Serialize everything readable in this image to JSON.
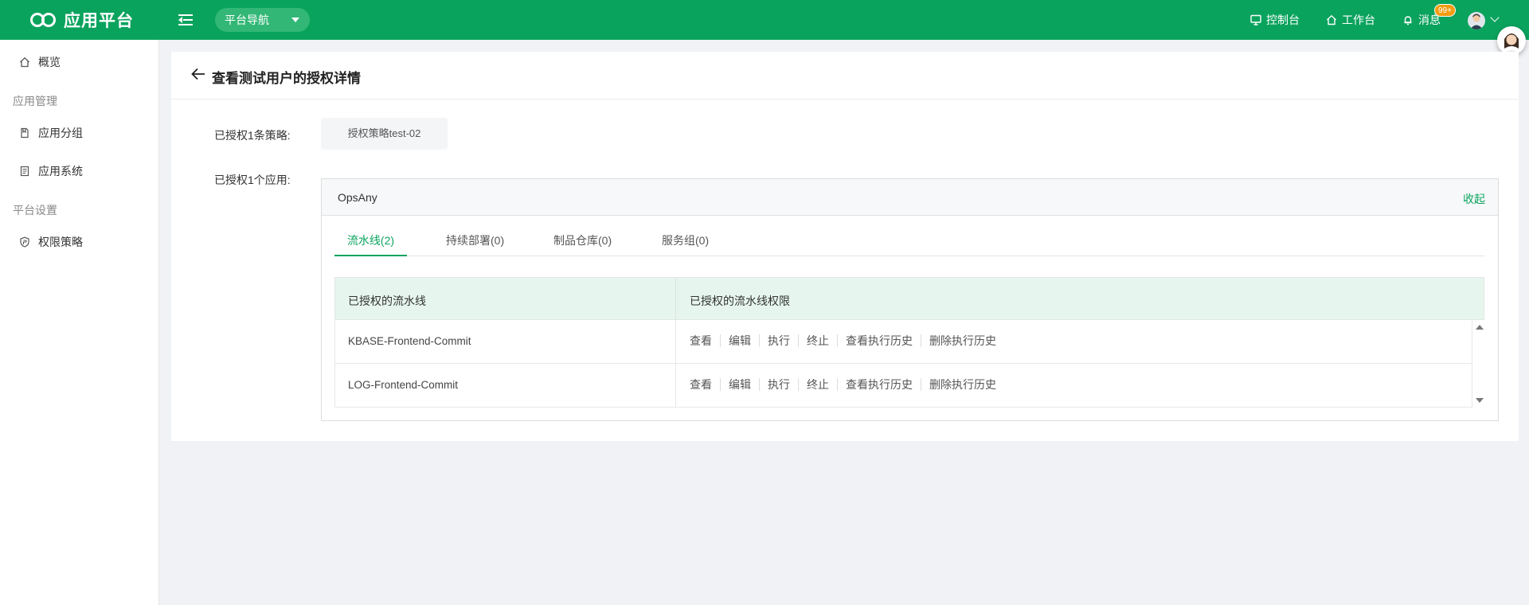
{
  "header": {
    "logo_text": "应用平台",
    "nav_dropdown": "平台导航",
    "links": {
      "console": "控制台",
      "workbench": "工作台",
      "messages": "消息"
    },
    "message_badge": "99+",
    "brand_color": "#0aa35e"
  },
  "sidebar": {
    "overview": "概览",
    "group_app_mgmt": "应用管理",
    "app_group": "应用分组",
    "app_system": "应用系统",
    "group_platform": "平台设置",
    "permission_policy": "权限策略"
  },
  "page": {
    "title": "查看测试用户的授权详情",
    "policies_label": "已授权1条策略:",
    "policy_tag": "授权策略test-02",
    "apps_label": "已授权1个应用:"
  },
  "app_panel": {
    "app_name": "OpsAny",
    "collapse": "收起",
    "tabs": [
      "流水线(2)",
      "持续部署(0)",
      "制品仓库(0)",
      "服务组(0)"
    ],
    "active_tab": 0,
    "table": {
      "columns": [
        "已授权的流水线",
        "已授权的流水线权限"
      ],
      "rows": [
        {
          "name": "KBASE-Frontend-Commit",
          "permissions": [
            "查看",
            "编辑",
            "执行",
            "终止",
            "查看执行历史",
            "删除执行历史"
          ]
        },
        {
          "name": "LOG-Frontend-Commit",
          "permissions": [
            "查看",
            "编辑",
            "执行",
            "终止",
            "查看执行历史",
            "删除执行历史"
          ]
        }
      ]
    }
  }
}
